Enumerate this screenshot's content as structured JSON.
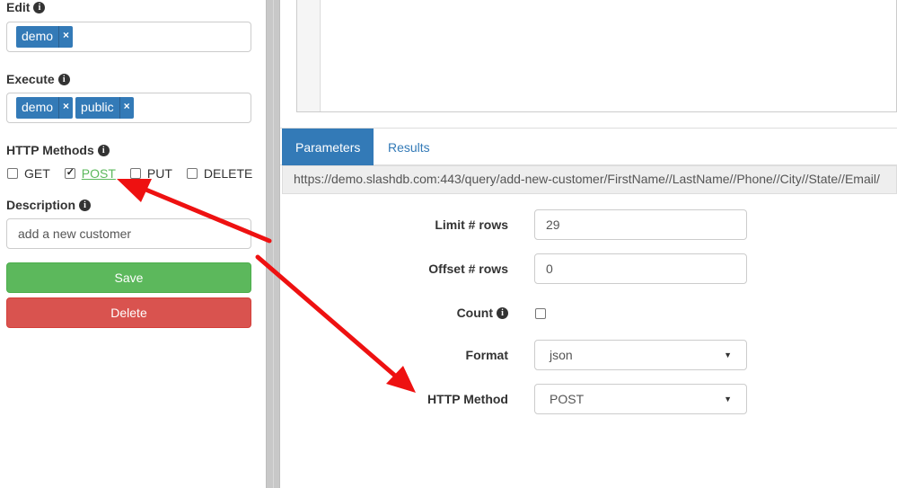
{
  "sidebar": {
    "edit": {
      "label": "Edit",
      "tags": [
        "demo"
      ]
    },
    "execute": {
      "label": "Execute",
      "tags": [
        "demo",
        "public"
      ]
    },
    "http_methods": {
      "label": "HTTP Methods",
      "items": [
        {
          "label": "GET",
          "checked": false
        },
        {
          "label": "POST",
          "checked": true
        },
        {
          "label": "PUT",
          "checked": false
        },
        {
          "label": "DELETE",
          "checked": false
        }
      ]
    },
    "description": {
      "label": "Description",
      "value": "add a new customer"
    },
    "save_label": "Save",
    "delete_label": "Delete",
    "tag_remove": "×"
  },
  "tabs": {
    "parameters": "Parameters",
    "results": "Results"
  },
  "url": "https://demo.slashdb.com:443/query/add-new-customer/FirstName//LastName//Phone//City//State//Email/",
  "params": {
    "limit": {
      "label": "Limit # rows",
      "value": "29"
    },
    "offset": {
      "label": "Offset # rows",
      "value": "0"
    },
    "count": {
      "label": "Count",
      "checked": false
    },
    "format": {
      "label": "Format",
      "value": "json"
    },
    "http_method": {
      "label": "HTTP Method",
      "value": "POST"
    }
  },
  "colors": {
    "primary": "#337ab7",
    "success": "#5cb85c",
    "danger": "#d9534f",
    "annotation": "#ee1111"
  }
}
